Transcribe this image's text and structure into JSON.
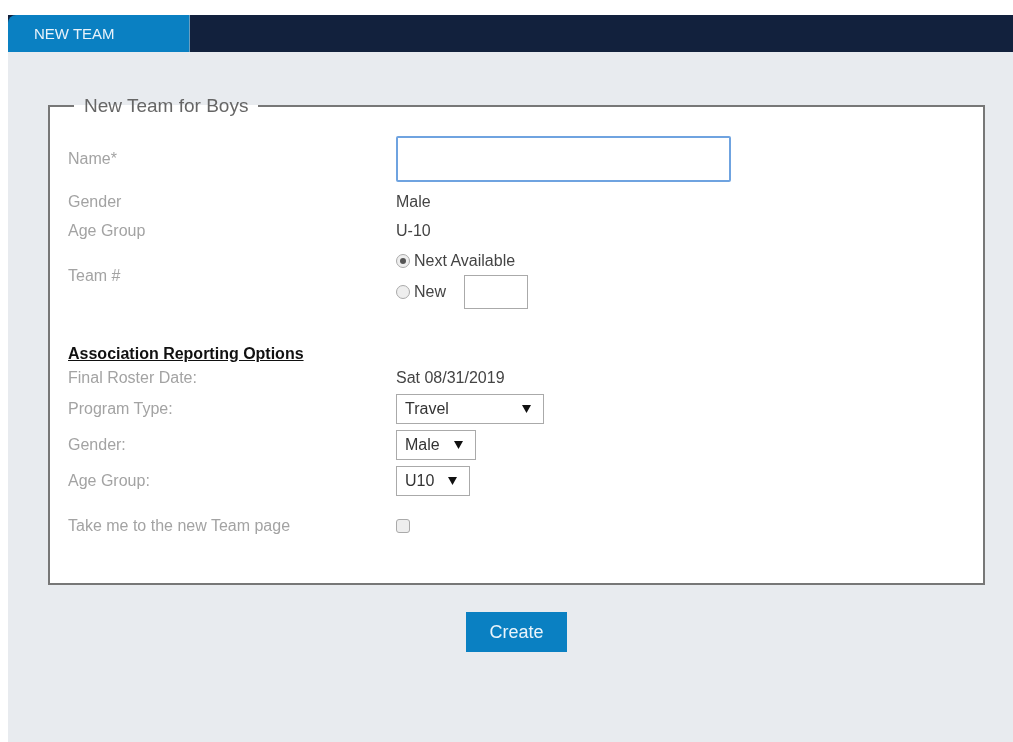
{
  "tabs": [
    {
      "label": "NEW TEAM",
      "selected": true
    }
  ],
  "form": {
    "legend": "New Team for Boys",
    "name": {
      "label": "Name*",
      "focused": true
    },
    "info": [
      {
        "label": "Gender",
        "value": "Male"
      },
      {
        "label": "Age Group",
        "value": "U-10"
      }
    ],
    "team_number": {
      "label": "Team #",
      "options": [
        {
          "label": "Next Available",
          "selected": true
        },
        {
          "label": "New",
          "selected": false
        }
      ]
    },
    "reporting": {
      "heading": "Association Reporting Options",
      "final_roster_date": {
        "label": "Final Roster Date:",
        "value": "Sat 08/31/2019"
      },
      "selects": [
        {
          "label": "Program Type:",
          "value": "Travel"
        },
        {
          "label": "Gender:",
          "value": "Male"
        },
        {
          "label": "Age Group:",
          "value": "U10"
        }
      ],
      "redirect": {
        "label": "Take me to the new Team page",
        "checked": false
      }
    }
  },
  "button": "Create"
}
